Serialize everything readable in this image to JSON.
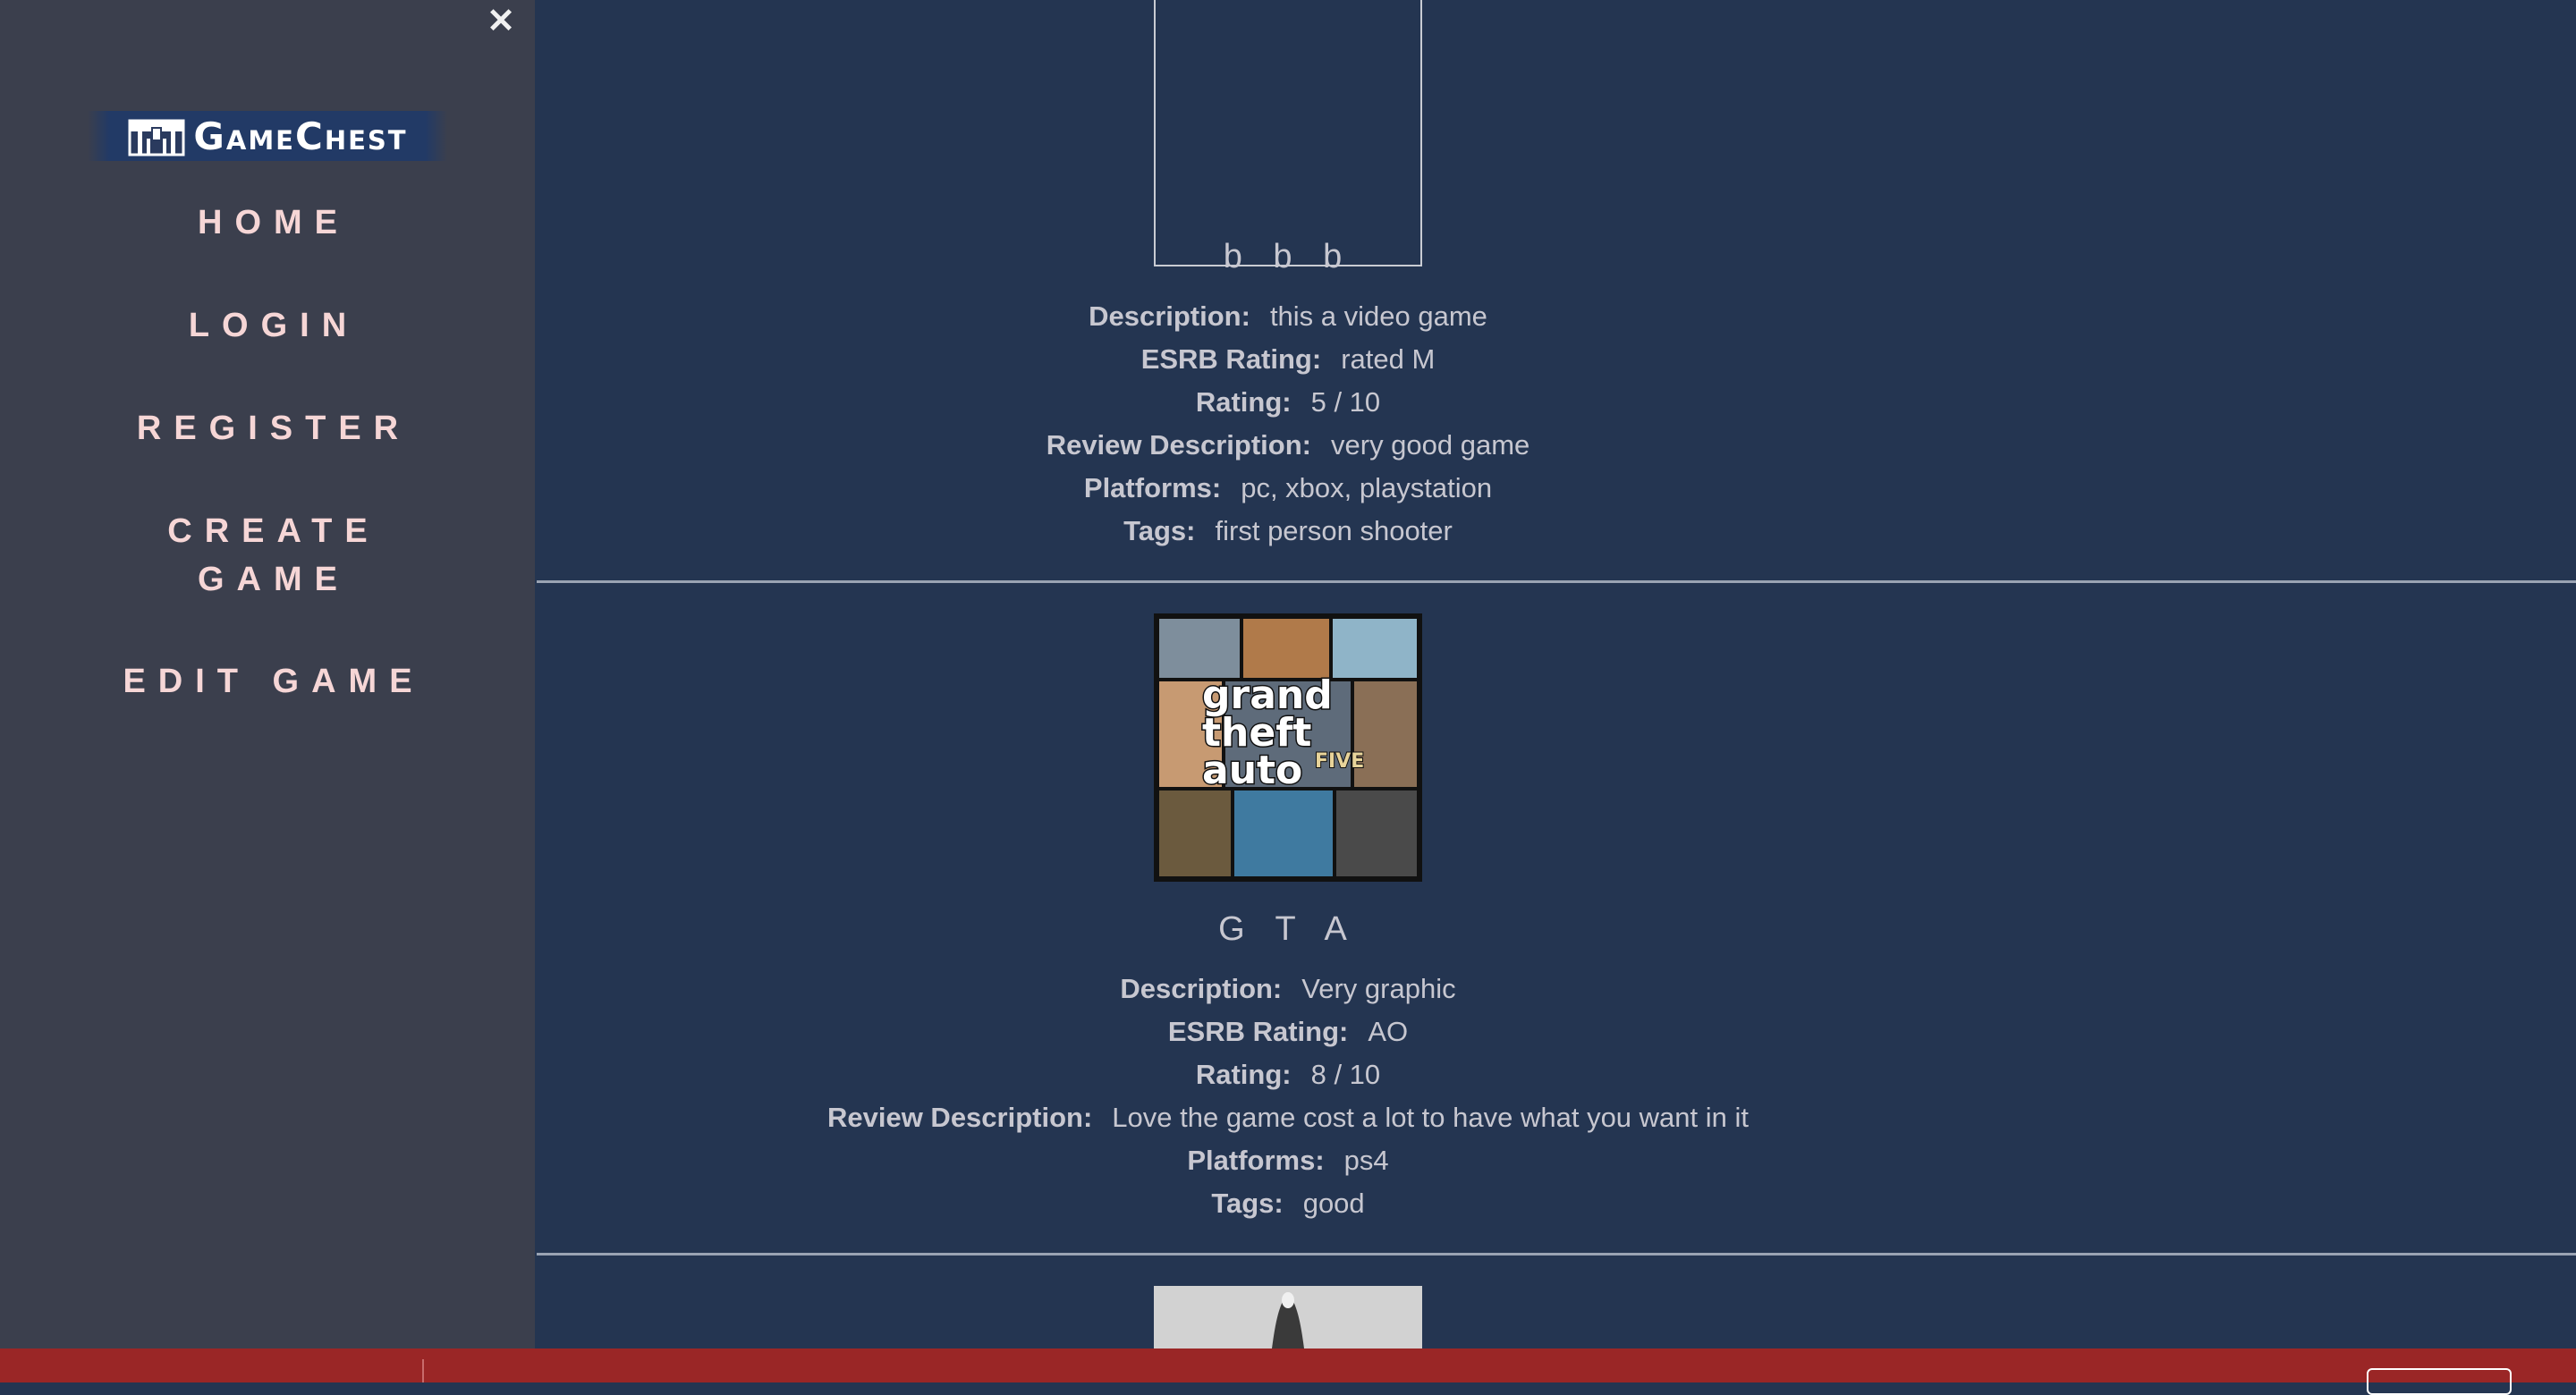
{
  "sidebar": {
    "close_label": "✕",
    "logo_text": "GameChest",
    "nav": [
      {
        "label": "HOME"
      },
      {
        "label": "LOGIN"
      },
      {
        "label": "REGISTER"
      },
      {
        "label_line1": "CREATE",
        "label_line2": "GAME"
      },
      {
        "label": "EDIT GAME"
      }
    ]
  },
  "labels": {
    "description": "Description:",
    "esrb": "ESRB Rating:",
    "rating": "Rating:",
    "review": "Review Description:",
    "platforms": "Platforms:",
    "tags": "Tags:"
  },
  "games": [
    {
      "title": "b b b",
      "description": "this a video game",
      "esrb": "rated M",
      "rating": "5 / 10",
      "review": "very good game",
      "platforms": "pc, xbox, playstation",
      "tags": "first person shooter"
    },
    {
      "title": "G T A",
      "cover_text": [
        "grand",
        "theft",
        "auto",
        "FIVE"
      ],
      "description": "Very graphic",
      "esrb": "AO",
      "rating": "8 / 10",
      "review": "Love the game cost a lot to have what you want in it",
      "platforms": "ps4",
      "tags": "good"
    }
  ],
  "colors": {
    "main_bg": "#243551",
    "sidebar_bg": "#3b3f4d",
    "nav_text": "#f6d6d6",
    "bottom_bar": "#9a2626"
  }
}
